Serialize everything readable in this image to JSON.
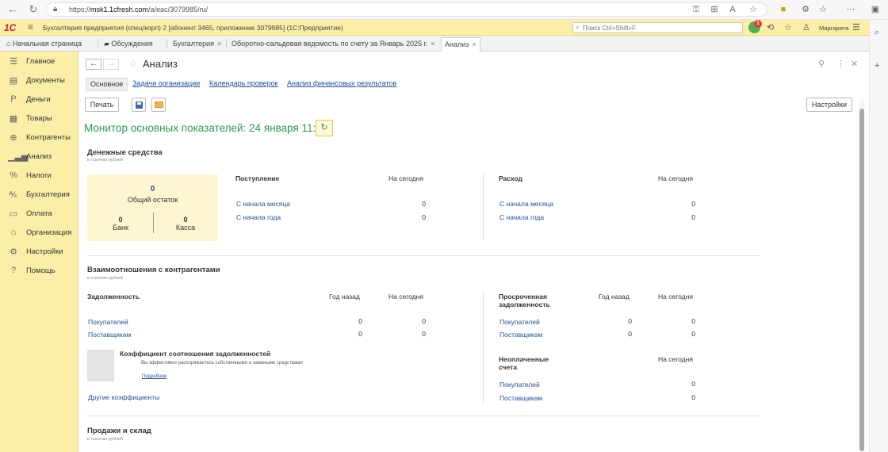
{
  "browser": {
    "url_prefix": "https://",
    "url_host": "msk1.1cfresh.com",
    "url_path": "/a/eac/3079985/ru/"
  },
  "app": {
    "title": "Бухгалтерия предприятия (спец/корп) 2 [абонент 3465, приложение 3079985]  (1С:Предприятие)",
    "search_placeholder": "Поиск Ctrl+Shift+F",
    "notification_count": "1",
    "user_name": "Маргарита"
  },
  "tabs": [
    {
      "label": "Начальная страница",
      "closable": false
    },
    {
      "label": "Обсуждения",
      "closable": false
    },
    {
      "label": "Бухгалтерия",
      "closable": true
    },
    {
      "label": "Оборотно-сальдовая ведомость по счету за Январь 2025 г.",
      "closable": true
    },
    {
      "label": "Анализ",
      "closable": true
    }
  ],
  "close_glyph": "×",
  "sidebar": {
    "items": [
      {
        "label": "Главное",
        "icon": "menu-lines-icon"
      },
      {
        "label": "Документы",
        "icon": "document-icon"
      },
      {
        "label": "Деньги",
        "icon": "ruble-icon"
      },
      {
        "label": "Товары",
        "icon": "grid-icon"
      },
      {
        "label": "Контрагенты",
        "icon": "handshake-icon"
      },
      {
        "label": "Анализ",
        "icon": "bar-chart-icon"
      },
      {
        "label": "Налоги",
        "icon": "percent-icon"
      },
      {
        "label": "Бухгалтерия",
        "icon": "dt-kt-icon"
      },
      {
        "label": "Оплата",
        "icon": "payment-icon"
      },
      {
        "label": "Организация",
        "icon": "home-icon"
      },
      {
        "label": "Настройки",
        "icon": "gear-icon"
      },
      {
        "label": "Помощь",
        "icon": "question-icon"
      }
    ]
  },
  "page": {
    "title": "Анализ",
    "subtabs": [
      "Основное",
      "Задачи организации",
      "Календарь проверок",
      "Анализ финансовых результатов"
    ],
    "print_button": "Печать",
    "settings_button": "Настройки",
    "monitor_title": "Монитор основных показателей: 24 января 11:15"
  },
  "cash": {
    "title": "Денежные средства",
    "units": "в тысячах рублей",
    "total_value": "0",
    "total_label": "Общий остаток",
    "bank_value": "0",
    "bank_label": "Банк",
    "cashbox_value": "0",
    "cashbox_label": "Касса",
    "income": {
      "header": "Поступление",
      "col": "На сегодня",
      "rows": [
        {
          "label": "С начала месяца",
          "value": "0"
        },
        {
          "label": "С начала года",
          "value": "0"
        }
      ]
    },
    "expense": {
      "header": "Расход",
      "col": "На сегодня",
      "rows": [
        {
          "label": "С начала месяца",
          "value": "0"
        },
        {
          "label": "С начала года",
          "value": "0"
        }
      ]
    }
  },
  "counterparties": {
    "title": "Взаимоотношения с контрагентами",
    "units": "в тысячах рублей",
    "debt": {
      "header": "Задолженность",
      "col_year": "Год назад",
      "col_today": "На сегодня",
      "rows": [
        {
          "label": "Покупателей",
          "year": "0",
          "today": "0"
        },
        {
          "label": "Поставщикам",
          "year": "0",
          "today": "0"
        }
      ]
    },
    "overdue": {
      "header": "Просроченная задолженность",
      "col_year": "Год назад",
      "col_today": "На сегодня",
      "rows": [
        {
          "label": "Покупателей",
          "year": "0",
          "today": "0"
        },
        {
          "label": "Поставщикам",
          "year": "0",
          "today": "0"
        }
      ]
    },
    "ratio": {
      "title": "Коэффициент соотношения задолженностей",
      "text": "Вы эффективно распоряжаетесь собственными и заемными средствами",
      "more": "Подробнее",
      "other": "Другие коэффициенты"
    },
    "unpaid": {
      "header": "Неоплаченные счета",
      "col_today": "На сегодня",
      "rows": [
        {
          "label": "Покупателей",
          "today": "0"
        },
        {
          "label": "Поставщикам",
          "today": "0"
        }
      ]
    }
  },
  "sales": {
    "title": "Продажи и склад",
    "units": "в тысячах рублей"
  }
}
